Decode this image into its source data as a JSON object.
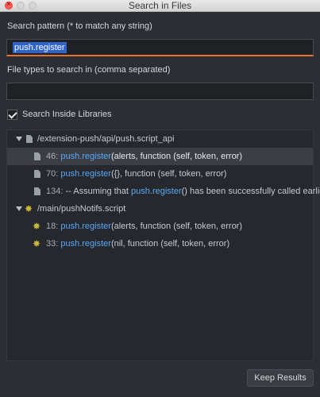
{
  "window": {
    "title": "Search in Files"
  },
  "search": {
    "label": "Search pattern (* to match any string)",
    "value": "push.register"
  },
  "filetypes": {
    "label": "File types to search in (comma separated)",
    "value": ""
  },
  "libraries": {
    "label": "Search Inside Libraries",
    "checked": true
  },
  "results": {
    "group1": {
      "path": "/extension-push/api/push.script_api",
      "items": [
        {
          "line": "46:",
          "pre": "",
          "match": "push.register",
          "post": "(alerts, function (self, token, error)"
        },
        {
          "line": "70:",
          "pre": "",
          "match": "push.register",
          "post": "({}, function (self, token, error)"
        },
        {
          "line": "134:",
          "pre": "-- Assuming that ",
          "match": "push.register",
          "post": "() has been successfully called earlier"
        }
      ]
    },
    "group2": {
      "path": "/main/pushNotifs.script",
      "items": [
        {
          "line": "18:",
          "pre": "",
          "match": "push.register",
          "post": "(alerts, function (self, token, error)"
        },
        {
          "line": "33:",
          "pre": "",
          "match": "push.register",
          "post": "(nil, function (self, token, error)"
        }
      ]
    }
  },
  "actions": {
    "keep_results": "Keep Results"
  },
  "colors": {
    "accent": "#e8702a",
    "match": "#5aa8f5",
    "selection": "#2f65ca"
  }
}
